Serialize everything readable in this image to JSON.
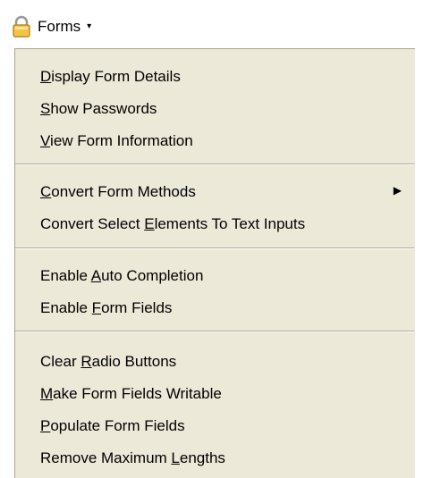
{
  "toolbar": {
    "forms_label": "Forms",
    "forms_icon": "padlock-icon",
    "dropdown_indicator": "▾"
  },
  "menu": {
    "items": [
      {
        "pre": "",
        "key": "D",
        "post": "isplay Form Details"
      },
      {
        "pre": "",
        "key": "S",
        "post": "how Passwords"
      },
      {
        "pre": "",
        "key": "V",
        "post": "iew Form Information"
      },
      {
        "pre": "",
        "key": "C",
        "post": "onvert Form Methods",
        "submenu": true
      },
      {
        "pre": "Convert Select ",
        "key": "E",
        "post": "lements To Text Inputs"
      },
      {
        "pre": "Enable ",
        "key": "A",
        "post": "uto Completion"
      },
      {
        "pre": "Enable ",
        "key": "F",
        "post": "orm Fields"
      },
      {
        "pre": "Clear ",
        "key": "R",
        "post": "adio Buttons"
      },
      {
        "pre": "",
        "key": "M",
        "post": "ake Form Fields Writable"
      },
      {
        "pre": "",
        "key": "P",
        "post": "opulate Form Fields"
      },
      {
        "pre": "Remove Maximum ",
        "key": "L",
        "post": "engths"
      }
    ],
    "submenu_arrow": "▶"
  }
}
